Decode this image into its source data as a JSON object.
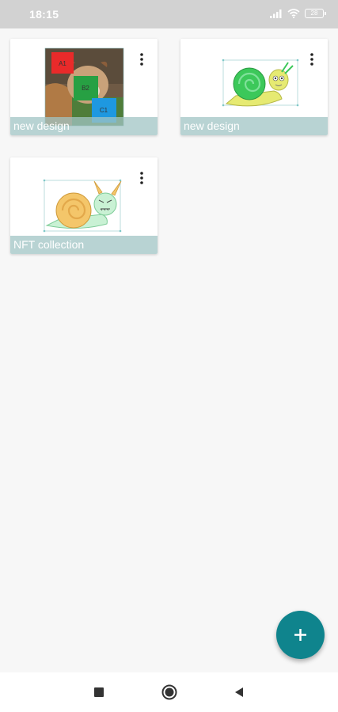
{
  "status_bar": {
    "time": "18:15",
    "battery_level": "28",
    "icons": [
      "signal-icon",
      "wifi-icon",
      "battery-icon"
    ]
  },
  "designs": [
    {
      "title": "new design",
      "thumbnail": "dog-photo-with-boxes",
      "boxes": [
        "A1",
        "B2",
        "C1"
      ],
      "menu_icon": "more-vert-icon"
    },
    {
      "title": "new design",
      "thumbnail": "green-snail-drawing",
      "menu_icon": "more-vert-icon"
    },
    {
      "title": "NFT collection",
      "thumbnail": "orange-snail-drawing",
      "menu_icon": "more-vert-icon"
    }
  ],
  "fab": {
    "icon": "plus-icon",
    "color": "#0f848d"
  },
  "nav_bar": {
    "buttons": [
      "recents-square-icon",
      "home-circle-icon",
      "back-triangle-icon"
    ]
  },
  "colors": {
    "accent": "#0f848d",
    "label_band": "#a0c4c4",
    "background": "#f7f7f7",
    "status_bar": "#d2d2d2"
  }
}
